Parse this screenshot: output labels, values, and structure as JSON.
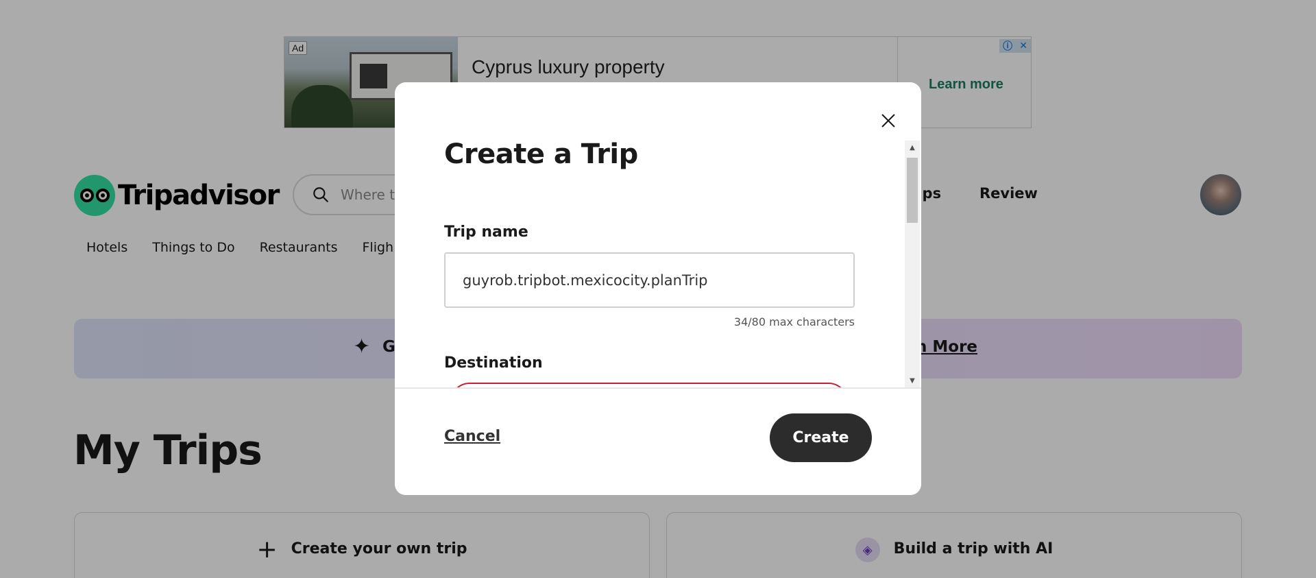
{
  "ad": {
    "badge": "Ad",
    "title": "Cyprus luxury property",
    "cta": "Learn more",
    "info_icon": "info-icon",
    "close_icon": "close-icon"
  },
  "header": {
    "brand": "Tripadvisor",
    "search_placeholder": "Where to",
    "nav_trips": "rips",
    "nav_review": "Review"
  },
  "categories": [
    "Hotels",
    "Things to Do",
    "Restaurants",
    "Fligh"
  ],
  "promo": {
    "partial_text": "G",
    "more_link": "n More"
  },
  "page": {
    "title": "My Trips"
  },
  "cards": {
    "own_trip": "Create your own trip",
    "ai_trip": "Build a trip with AI"
  },
  "modal": {
    "title": "Create a Trip",
    "trip_name_label": "Trip name",
    "trip_name_value": "guyrob.tripbot.mexicocity.planTrip",
    "char_count": "34/80 max characters",
    "destination_label": "Destination",
    "cancel_label": "Cancel",
    "create_label": "Create"
  },
  "colors": {
    "brand_green": "#34e0a1",
    "cta_green": "#1a7e63",
    "error_red": "#c4203a",
    "button_dark": "#2c2c2c"
  }
}
